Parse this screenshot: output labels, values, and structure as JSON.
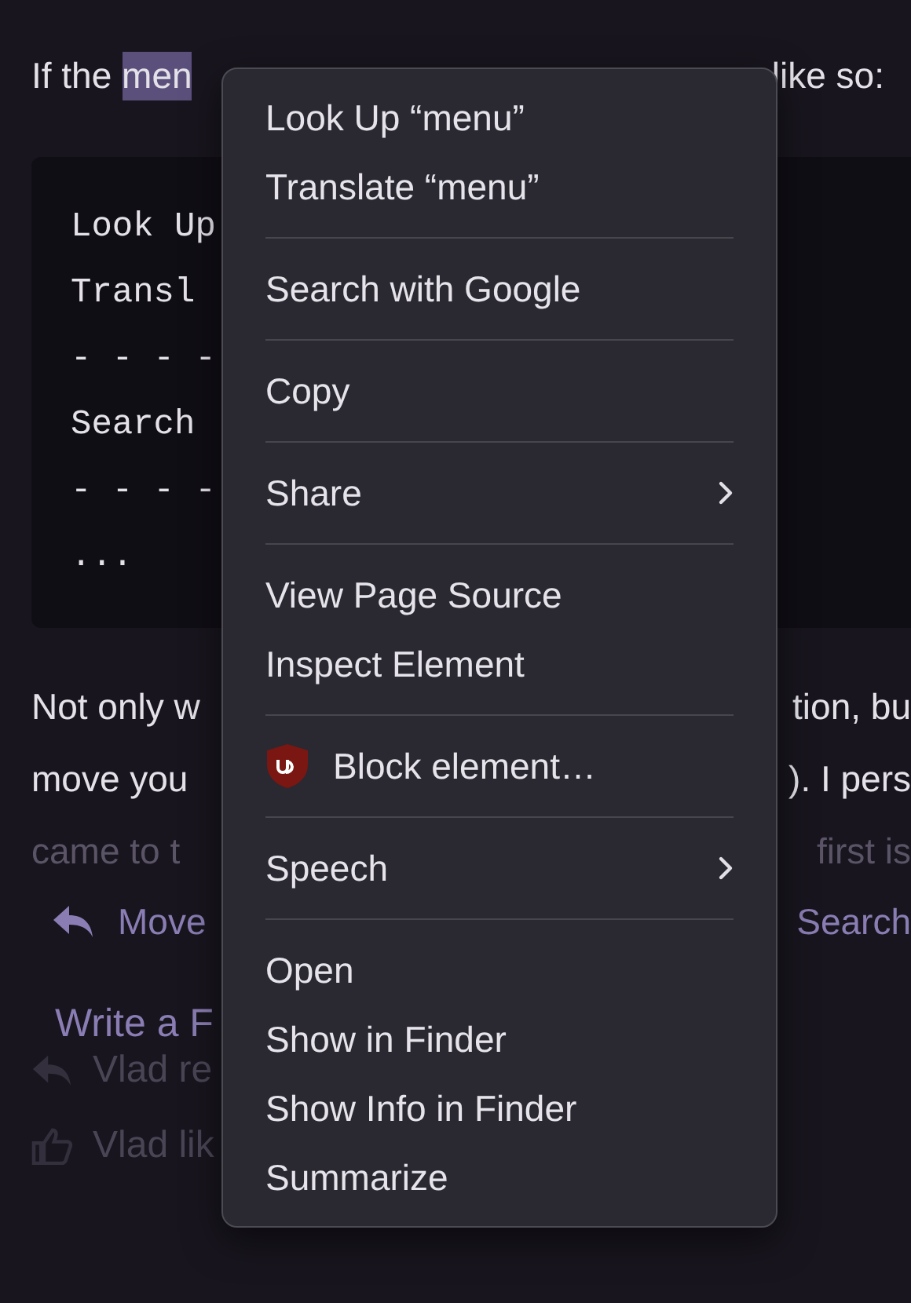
{
  "intro": {
    "left": "If the",
    "selection": "men",
    "right": "like so:"
  },
  "code_block": {
    "lines": [
      "Look Up",
      "Transl",
      "- - - -",
      "Search",
      "- - - -",
      "..."
    ]
  },
  "paragraph": [
    {
      "left": "Not only w",
      "right": "tion, bu",
      "faded": false
    },
    {
      "left": "move you",
      "right": "). I pers",
      "faded": false
    },
    {
      "left": "came to t",
      "right": "first is",
      "faded": true
    }
  ],
  "actions": {
    "left": "Move",
    "right": "Search"
  },
  "reply_link": "Write a F",
  "activity": [
    {
      "kind": "reply",
      "text": "Vlad re"
    },
    {
      "kind": "like",
      "text": "Vlad lik"
    }
  ],
  "context_menu": {
    "items": [
      {
        "kind": "item",
        "label": "Look Up “menu”",
        "submenu": false
      },
      {
        "kind": "item",
        "label": "Translate “menu”",
        "submenu": false
      },
      {
        "kind": "separator"
      },
      {
        "kind": "item",
        "label": "Search with Google",
        "submenu": false
      },
      {
        "kind": "separator"
      },
      {
        "kind": "item",
        "label": "Copy",
        "submenu": false
      },
      {
        "kind": "separator"
      },
      {
        "kind": "item",
        "label": "Share",
        "submenu": true
      },
      {
        "kind": "separator"
      },
      {
        "kind": "item",
        "label": "View Page Source",
        "submenu": false
      },
      {
        "kind": "item",
        "label": "Inspect Element",
        "submenu": false
      },
      {
        "kind": "separator"
      },
      {
        "kind": "extension_item",
        "label": "Block element…",
        "submenu": false
      },
      {
        "kind": "separator"
      },
      {
        "kind": "item",
        "label": "Speech",
        "submenu": true
      },
      {
        "kind": "separator"
      },
      {
        "kind": "item",
        "label": "Open",
        "submenu": false
      },
      {
        "kind": "item",
        "label": "Show in Finder",
        "submenu": false
      },
      {
        "kind": "item",
        "label": "Show Info in Finder",
        "submenu": false
      },
      {
        "kind": "item",
        "label": "Summarize",
        "submenu": false
      }
    ]
  }
}
